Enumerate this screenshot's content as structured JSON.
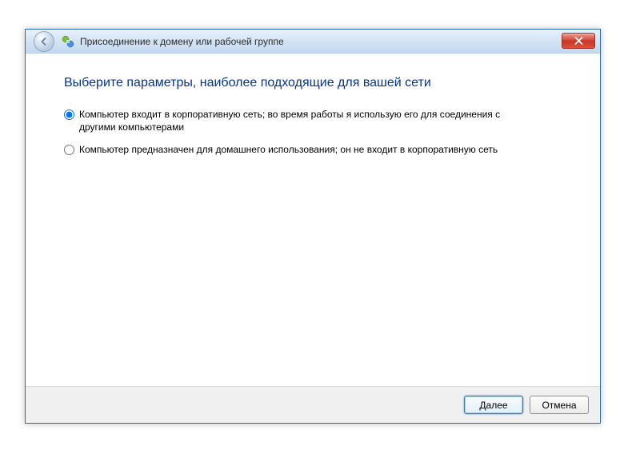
{
  "titlebar": {
    "text": "Присоединение к домену или рабочей группе"
  },
  "heading": "Выберите параметры, наиболее подходящие для вашей сети",
  "options": {
    "corporate": "Компьютер входит в корпоративную сеть; во время работы я использую его для соединения с другими компьютерами",
    "home": "Компьютер предназначен для домашнего использования; он не входит в корпоративную сеть"
  },
  "buttons": {
    "next": "Далее",
    "cancel": "Отмена"
  }
}
